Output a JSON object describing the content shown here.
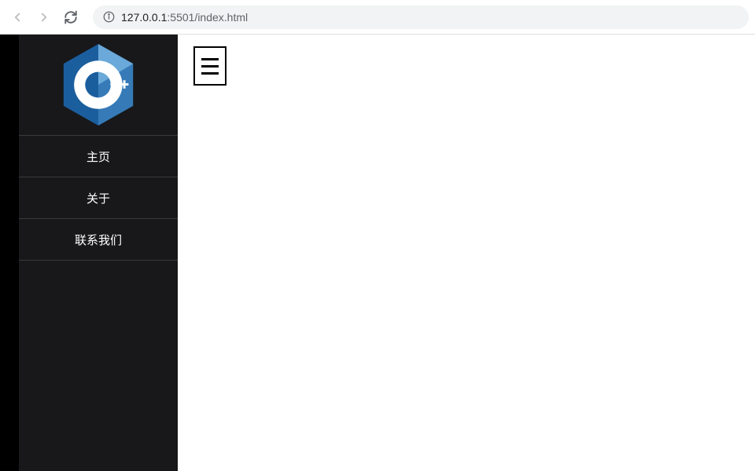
{
  "browser": {
    "url_host": "127.0.0.1",
    "url_port_path": ":5501/index.html"
  },
  "sidebar": {
    "logo_label": "C++",
    "items": [
      {
        "label": "主页"
      },
      {
        "label": "关于"
      },
      {
        "label": "联系我们"
      }
    ]
  }
}
